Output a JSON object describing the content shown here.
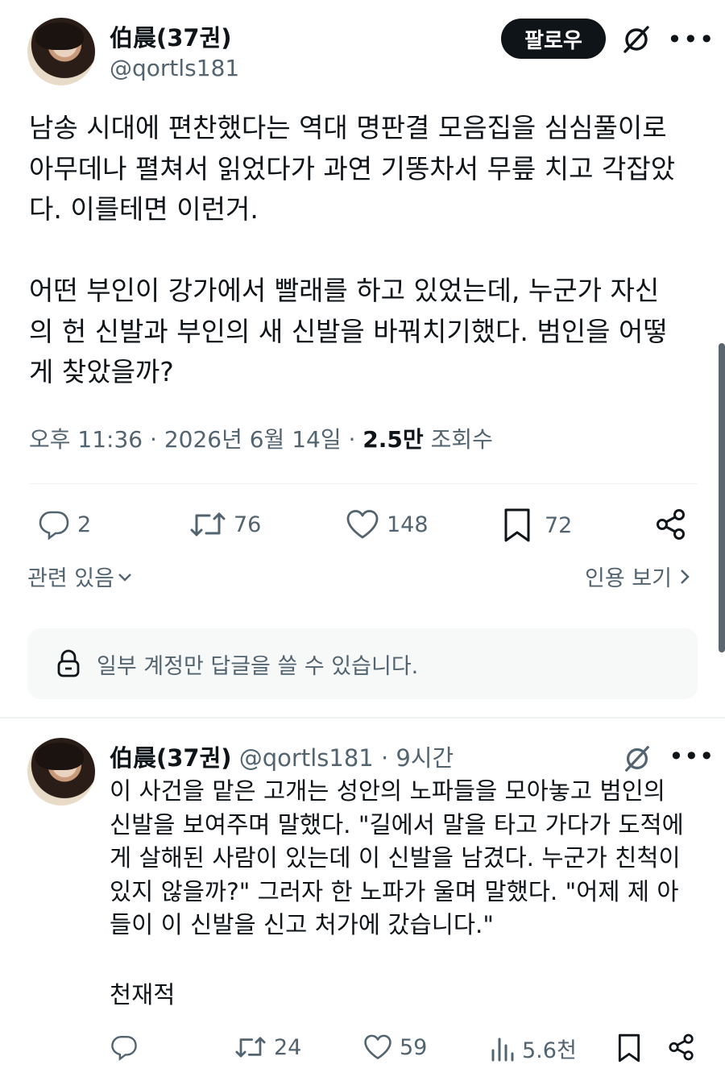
{
  "post": {
    "author_name": "伯晨(37권)",
    "author_handle": "@qortls181",
    "follow_label": "팔로우",
    "body": "남송 시대에 편찬했다는 역대 명판결 모음집을 심심풀이로\n아무데나 펼쳐서 읽었다가 과연 기똥차서 무릎 치고 각잡았\n다. 이를테면 이런거.\n\n어떤 부인이 강가에서 빨래를 하고 있었는데, 누군가 자신\n의 헌 신발과 부인의 새 신발을 바꿔치기했다. 범인을 어떻\n게 찾았을까?",
    "time": "오후 11:36 · 2026년 6월 14일 · ",
    "views_count": "2.5만",
    "views_label": " 조회수",
    "replies": "2",
    "reposts": "76",
    "likes": "148",
    "bookmarks": "72",
    "related_label": "관련 있음",
    "quotes_label": "인용 보기",
    "reply_notice": "일부 계정만 답글을 쓸 수 있습니다."
  },
  "reply": {
    "author_name": "伯晨(37권)",
    "author_handle": "@qortls181",
    "dot": " · ",
    "time": "9시간",
    "body": "이 사건을 맡은 고개는 성안의 노파들을 모아놓고 범인의\n신발을 보여주며 말했다. \"길에서 말을 타고 가다가 도적에\n게 살해된 사람이 있는데 이 신발을 남겼다. 누군가 친척이\n있지 않을까?\" 그러자 한 노파가 울며 말했다. \"어제 제 아\n들이 이 신발을 신고 처가에 갔습니다.\"",
    "sign": "천재적",
    "replies": "",
    "reposts": "24",
    "likes": "59",
    "views": "5.6천"
  },
  "icons": {
    "grok": "grok-slash-icon",
    "more": "more-dots-icon",
    "reply": "reply-bubble-icon",
    "repost": "repost-icon",
    "like": "heart-icon",
    "bookmark": "bookmark-icon",
    "share": "share-icon",
    "lock": "lock-icon",
    "views": "bar-chart-icon"
  },
  "colors": {
    "text": "#0f1419",
    "muted": "#536471",
    "follow_bg": "#0f1419",
    "notice_bg": "#f7f9f9"
  }
}
